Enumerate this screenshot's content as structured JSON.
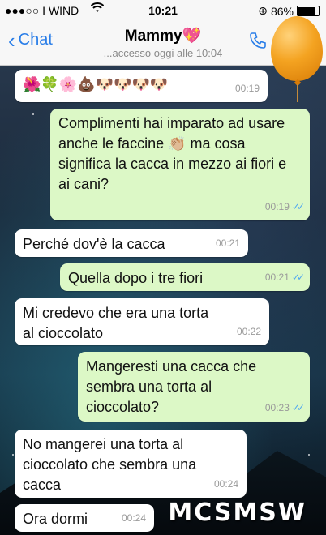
{
  "status_bar": {
    "carrier": "●●●○○ I WIND",
    "time": "10:21",
    "battery": "86%",
    "battery_level": 0.86
  },
  "header": {
    "back_label": "Chat",
    "contact_name": "Mammy",
    "status": "...accesso oggi alle 10:04"
  },
  "messages": [
    {
      "dir": "in",
      "text": "🌺🍀🌸💩🐶🐶🐶🐶",
      "time": "00:19"
    },
    {
      "dir": "out",
      "text": "Complimenti hai imparato ad usare anche le faccine 👏🏼 ma cosa significa la cacca in mezzo ai fiori e ai cani?",
      "time": "00:19",
      "ticks": "✓✓"
    },
    {
      "dir": "in",
      "text": "Perché dov'è la cacca",
      "time": "00:21"
    },
    {
      "dir": "out",
      "text": "Quella dopo i tre fiori",
      "time": "00:21",
      "ticks": "✓✓"
    },
    {
      "dir": "in",
      "text": "Mi credevo che era una torta al cioccolato",
      "time": "00:22"
    },
    {
      "dir": "out",
      "text": "Mangeresti una cacca che sembra una torta al cioccolato?",
      "time": "00:23",
      "ticks": "✓✓"
    },
    {
      "dir": "in",
      "text": "No mangerei una torta al cioccolato che sembra una cacca",
      "time": "00:24"
    },
    {
      "dir": "in",
      "text": "Ora dormi",
      "time": "00:24"
    }
  ],
  "watermark": "MCSMSW",
  "colors": {
    "accent": "#2a7ee8",
    "outgoing": "#dcf8c6",
    "incoming": "#ffffff",
    "balloon": "#f4a321"
  },
  "icons": {
    "wifi": "wifi-icon",
    "phone": "phone-icon",
    "heart": "heart-icon",
    "balloon": "balloon"
  }
}
